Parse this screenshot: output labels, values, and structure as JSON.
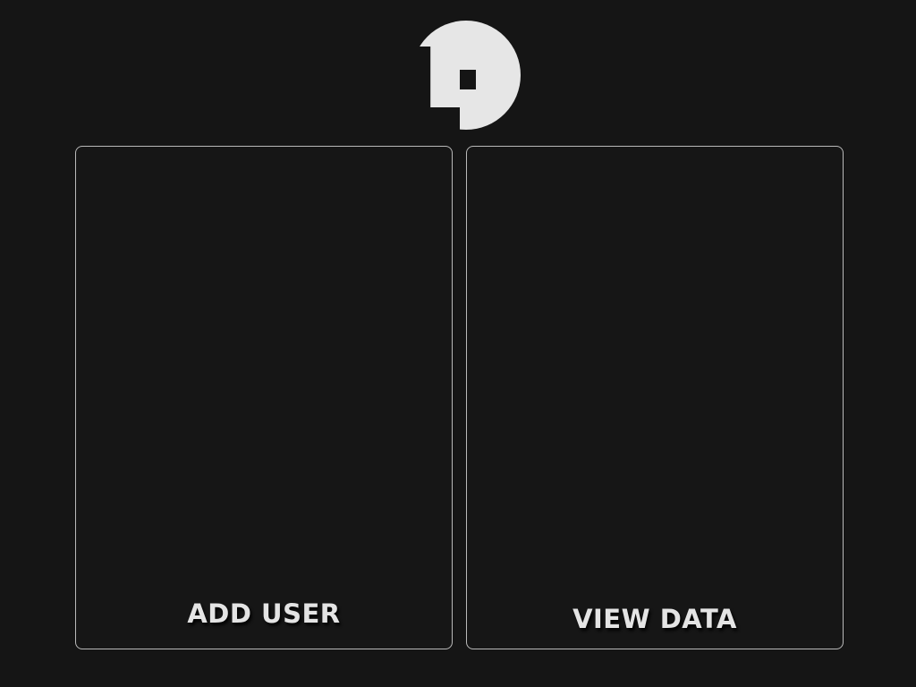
{
  "app": {
    "logo_icon": "p-logo-icon",
    "logo_color": "#e6e6e6",
    "background_color": "#151515"
  },
  "cards": {
    "add_user": {
      "label": "ADD USER"
    },
    "view_data": {
      "label": "VIEW DATA"
    }
  }
}
